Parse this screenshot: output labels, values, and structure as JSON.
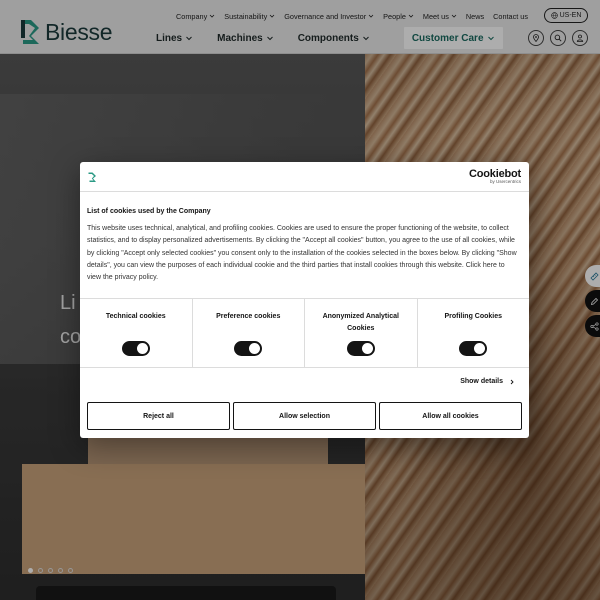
{
  "brand": {
    "name": "Biesse",
    "accent": "#1a6b60",
    "dark": "#1b3a3c"
  },
  "topnav": {
    "items": [
      {
        "label": "Company"
      },
      {
        "label": "Sustainability"
      },
      {
        "label": "Governance and Investor"
      },
      {
        "label": "People"
      },
      {
        "label": "Meet us"
      },
      {
        "label": "News"
      },
      {
        "label": "Contact us"
      }
    ],
    "language": "US-EN"
  },
  "mainnav": {
    "items": [
      {
        "label": "Lines"
      },
      {
        "label": "Machines"
      },
      {
        "label": "Components"
      },
      {
        "label": "Customer Care"
      }
    ]
  },
  "header_icons": [
    "location-pin-icon",
    "search-icon",
    "user-icon"
  ],
  "hero": {
    "text_line1": "Li",
    "text_line2": "co",
    "slides": 5,
    "active_slide": 1
  },
  "side_tabs": [
    "ruler-icon",
    "pencil-icon",
    "network-icon"
  ],
  "cookie_dialog": {
    "provider": "Cookiebot",
    "provider_by": "by Usercentrics",
    "title": "List of cookies used by the Company",
    "text": "This website uses technical, analytical, and profiling cookies. Cookies are used to ensure the proper functioning of the website, to collect statistics, and to display personalized advertisements. By clicking the \"Accept all cookies\" button, you agree to the use of all cookies, while by clicking \"Accept only selected cookies\" you consent only to the installation of the cookies selected in the boxes below. By clicking \"Show details\", you can view the purposes of each individual cookie and the third parties that install cookies through this website. Click here to view the privacy policy.",
    "categories": [
      {
        "label": "Technical cookies",
        "enabled": true
      },
      {
        "label": "Preference cookies",
        "enabled": true
      },
      {
        "label": "Anonymized Analytical Cookies",
        "enabled": true
      },
      {
        "label": "Profiling Cookies",
        "enabled": true
      }
    ],
    "show_details": "Show details",
    "buttons": {
      "reject": "Reject all",
      "allow_selection": "Allow selection",
      "allow_all": "Allow all cookies"
    }
  }
}
